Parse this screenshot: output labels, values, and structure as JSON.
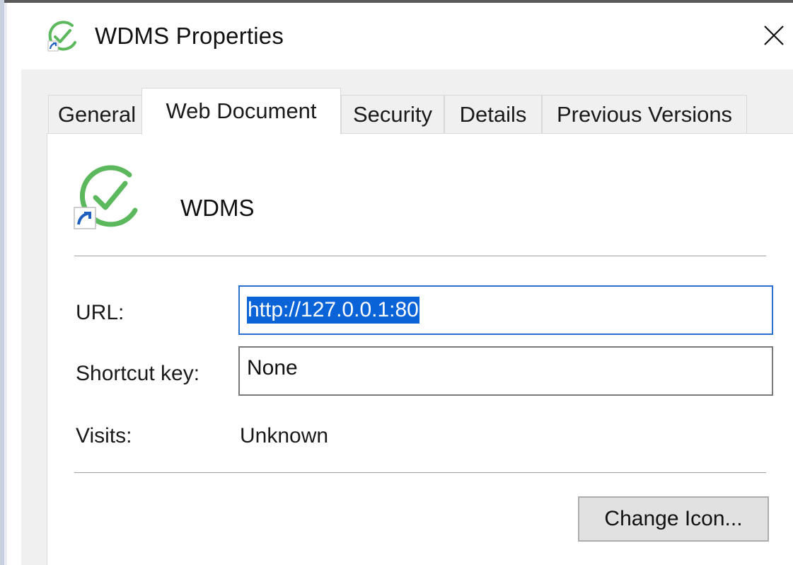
{
  "window": {
    "title": "WDMS Properties",
    "icon": "wdms-app-icon",
    "close_icon": "close-icon"
  },
  "tabs": [
    {
      "label": "General",
      "active": false
    },
    {
      "label": "Web Document",
      "active": true
    },
    {
      "label": "Security",
      "active": false
    },
    {
      "label": "Details",
      "active": false
    },
    {
      "label": "Previous Versions",
      "active": false
    }
  ],
  "page": {
    "app_name": "WDMS",
    "url_label": "URL:",
    "url_value": "http://127.0.0.1:80",
    "shortcut_label": "Shortcut key:",
    "shortcut_value": "None",
    "visits_label": "Visits:",
    "visits_value": "Unknown",
    "change_icon_label": "Change Icon..."
  },
  "colors": {
    "accent_green": "#4caf50",
    "selection_blue": "#0a64d8",
    "focus_border": "#2b6fd1",
    "shortcut_arrow": "#1f5fbf"
  }
}
